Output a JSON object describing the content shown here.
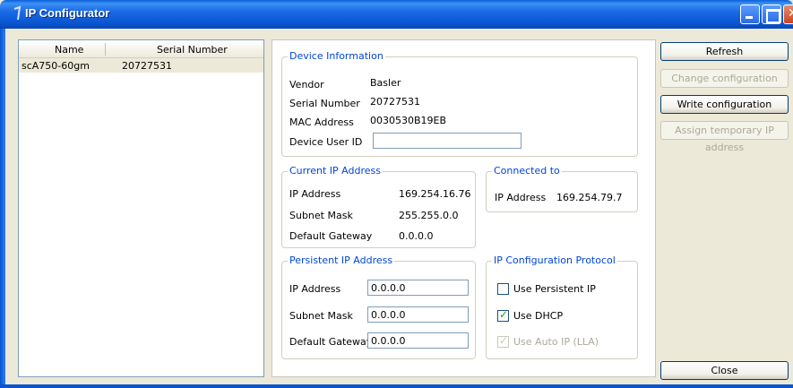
{
  "window": {
    "title": "IP Configurator"
  },
  "list": {
    "columns": [
      "Name",
      "Serial Number"
    ],
    "rows": [
      {
        "name": "scA750-60gm",
        "serial": "20727531"
      }
    ]
  },
  "device_info": {
    "title": "Device Information",
    "vendor_label": "Vendor",
    "vendor": "Basler",
    "serial_label": "Serial Number",
    "serial": "20727531",
    "mac_label": "MAC Address",
    "mac": "0030530B19EB",
    "user_id_label": "Device User ID",
    "user_id": ""
  },
  "current_ip": {
    "title": "Current IP Address",
    "ip_label": "IP Address",
    "ip": "169.254.16.76",
    "subnet_label": "Subnet Mask",
    "subnet": "255.255.0.0",
    "gateway_label": "Default Gateway",
    "gateway": "0.0.0.0"
  },
  "connected_to": {
    "title": "Connected to",
    "ip_label": "IP Address",
    "ip": "169.254.79.7"
  },
  "persistent_ip": {
    "title": "Persistent IP Address",
    "ip_label": "IP Address",
    "ip": "0.0.0.0",
    "subnet_label": "Subnet Mask",
    "subnet": "0.0.0.0",
    "gateway_label": "Default Gateway",
    "gateway": "0.0.0.0"
  },
  "protocol": {
    "title": "IP Configuration Protocol",
    "persistent_label": "Use Persistent IP",
    "persistent_checked": false,
    "dhcp_label": "Use DHCP",
    "dhcp_checked": true,
    "auto_label": "Use Auto IP (LLA)",
    "auto_checked": true,
    "auto_enabled": false
  },
  "buttons": {
    "refresh": "Refresh",
    "change": "Change configuration",
    "write": "Write configuration",
    "assign": "Assign temporary IP address",
    "close": "Close"
  }
}
